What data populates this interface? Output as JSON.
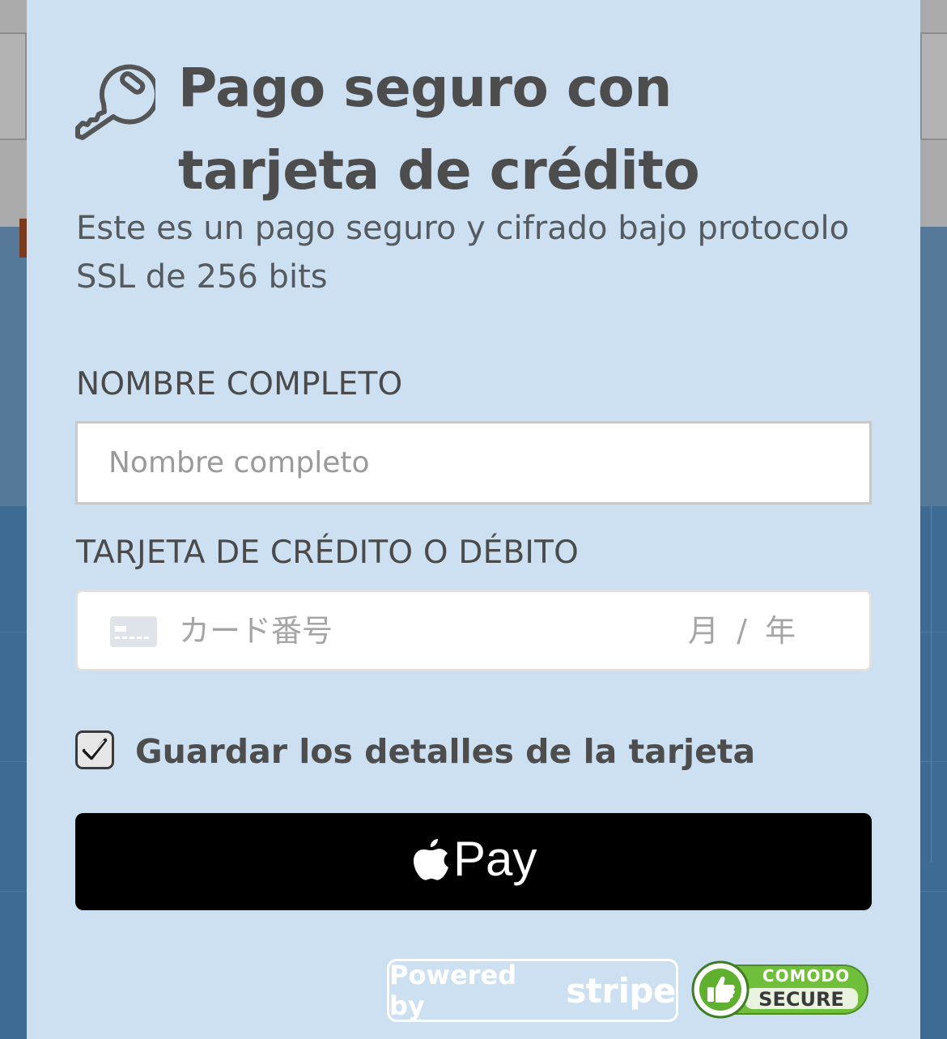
{
  "modal": {
    "title_line1": "Pago seguro con",
    "title_line2": "tarjeta de crédito",
    "subtitle_line1": "Este es un pago seguro y cifrado bajo protocolo",
    "subtitle_line2": "SSL de 256 bits",
    "name_field": {
      "label": "NOMBRE COMPLETO",
      "placeholder": "Nombre completo",
      "value": ""
    },
    "card_field": {
      "label": "TARJETA DE CRÉDITO O DÉBITO",
      "number_placeholder": "カード番号",
      "expiry_placeholder": "月 / 年",
      "icon": "credit-card-icon"
    },
    "save_card": {
      "label": "Guardar los detalles de la tarjeta",
      "checked": true
    },
    "apple_pay": {
      "label": "Pay",
      "icon": "apple-icon"
    },
    "badges": {
      "stripe_powered": "Powered by",
      "stripe_name": "stripe",
      "comodo_top": "COMODO",
      "comodo_bottom": "SECURE"
    },
    "header_icon": "key-icon"
  },
  "colors": {
    "modal_background": "#cde0f2",
    "text_dark": "#4d4d4d",
    "apple_pay_background": "#000000",
    "comodo_green": "#6fbf3a"
  }
}
